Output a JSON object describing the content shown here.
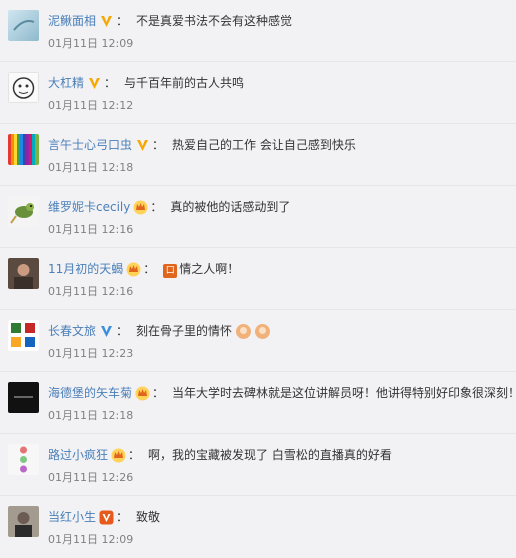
{
  "comments": [
    {
      "name": "泥鳅面相",
      "badge": "v-gold",
      "text": "不是真爱书法不会有这种感觉",
      "time": "01月11日 12:09",
      "avatar": "avatar-gradient-blue"
    },
    {
      "name": "大杠精",
      "badge": "v-gold",
      "text": "与千百年前的古人共鸣",
      "time": "01月11日 12:12",
      "avatar": "avatar-sketch-face"
    },
    {
      "name": "言午士心弓口虫",
      "badge": "v-gold",
      "text": "热爱自己的工作 会让自己感到快乐",
      "time": "01月11日 12:18",
      "avatar": "avatar-rainbow-stripes"
    },
    {
      "name": "维罗妮卡cecily",
      "badge": "crown",
      "text": "真的被他的话感动到了",
      "time": "01月11日 12:16",
      "avatar": "avatar-bird"
    },
    {
      "name": "11月初的天蝎",
      "badge": "crown",
      "text_icon": "口",
      "text": "情之人啊！",
      "time": "01月11日 12:16",
      "avatar": "avatar-photo-person"
    },
    {
      "name": "长春文旅",
      "badge": "v-blue",
      "text": "刻在骨子里的情怀",
      "time": "01月11日 12:23",
      "avatar": "avatar-calligraphy-logo",
      "emoji": [
        "clap-hands",
        "clap-hands"
      ]
    },
    {
      "name": "海德堡的矢车菊",
      "badge": "crown",
      "text": "当年大学时去碑林就是这位讲解员呀！他讲得特别好印象很深刻！",
      "time": "01月11日 12:18",
      "avatar": "avatar-dark"
    },
    {
      "name": "路过小疯狂",
      "badge": "crown",
      "text": "啊，我的宝藏被发现了 白雪松的直播真的好看",
      "time": "01月11日 12:26",
      "avatar": "avatar-dots"
    },
    {
      "name": "当红小生",
      "badge": "v-orange",
      "text": "致敬",
      "time": "01月11日 12:09",
      "avatar": "avatar-photo-face"
    }
  ],
  "colors": {
    "name": "#4a7fb8",
    "text": "#333333",
    "time": "#808080",
    "bg": "#f2f2f5",
    "v_gold": "#f7a700",
    "v_blue": "#3b8de0",
    "v_orange": "#e85a1c",
    "crown": "#ffb400"
  }
}
